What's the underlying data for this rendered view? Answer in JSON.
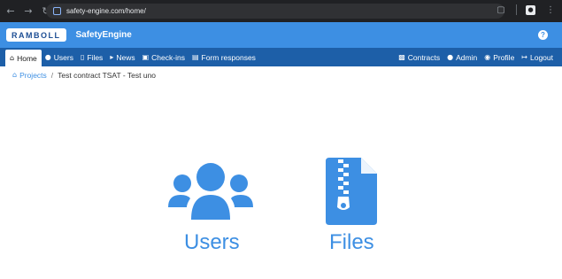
{
  "browser": {
    "url": "safety-engine.com/home/",
    "icons": [
      "back-arrow-icon",
      "forward-arrow-icon",
      "reload-icon",
      "extensions-icon",
      "profile-icon",
      "menu-icon"
    ]
  },
  "header": {
    "logo_text": "RAMBOLL",
    "app_title": "SafetyEngine",
    "help_label": "?"
  },
  "nav": {
    "left": [
      {
        "label": "Home",
        "icon": "home-icon",
        "active": true
      },
      {
        "label": "Users",
        "icon": "users-icon"
      },
      {
        "label": "Files",
        "icon": "file-icon"
      },
      {
        "label": "News",
        "icon": "megaphone-icon"
      },
      {
        "label": "Check-ins",
        "icon": "checkin-icon"
      },
      {
        "label": "Form responses",
        "icon": "form-icon"
      }
    ],
    "right": [
      {
        "label": "Contracts",
        "icon": "contract-icon"
      },
      {
        "label": "Admin",
        "icon": "admin-icon"
      },
      {
        "label": "Profile",
        "icon": "profile-icon"
      },
      {
        "label": "Logout",
        "icon": "logout-icon"
      }
    ]
  },
  "breadcrumb": {
    "root": "Projects",
    "separator": "/",
    "current": "Test contract TSAT - Test uno"
  },
  "tiles": {
    "users_label": "Users",
    "files_label": "Files"
  },
  "colors": {
    "header_bg": "#3d8fe3",
    "nav_bg": "#1d5fa8",
    "accent": "#3d8fe3"
  }
}
